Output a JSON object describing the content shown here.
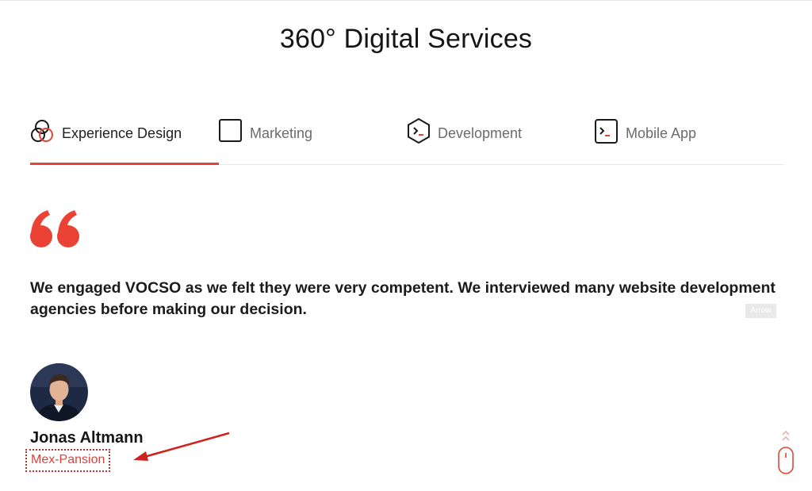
{
  "page": {
    "title": "360° Digital Services"
  },
  "tabs": [
    {
      "label": "Experience Design",
      "icon": "overlapping-circles-icon",
      "active": true
    },
    {
      "label": "Marketing",
      "icon": "square-icon",
      "active": false
    },
    {
      "label": "Development",
      "icon": "hexagon-terminal-icon",
      "active": false
    },
    {
      "label": "Mobile App",
      "icon": "terminal-icon",
      "active": false
    }
  ],
  "testimonial": {
    "quote": "We engaged VOCSO as we felt they were very competent. We interviewed many website development agencies before making our decision.",
    "badge": "Arrow",
    "name": "Jonas Altmann",
    "company": "Mex-Pansion"
  },
  "colors": {
    "accent": "#e2453a",
    "annotation": "#d0211c",
    "text": "#1a1a1a"
  }
}
